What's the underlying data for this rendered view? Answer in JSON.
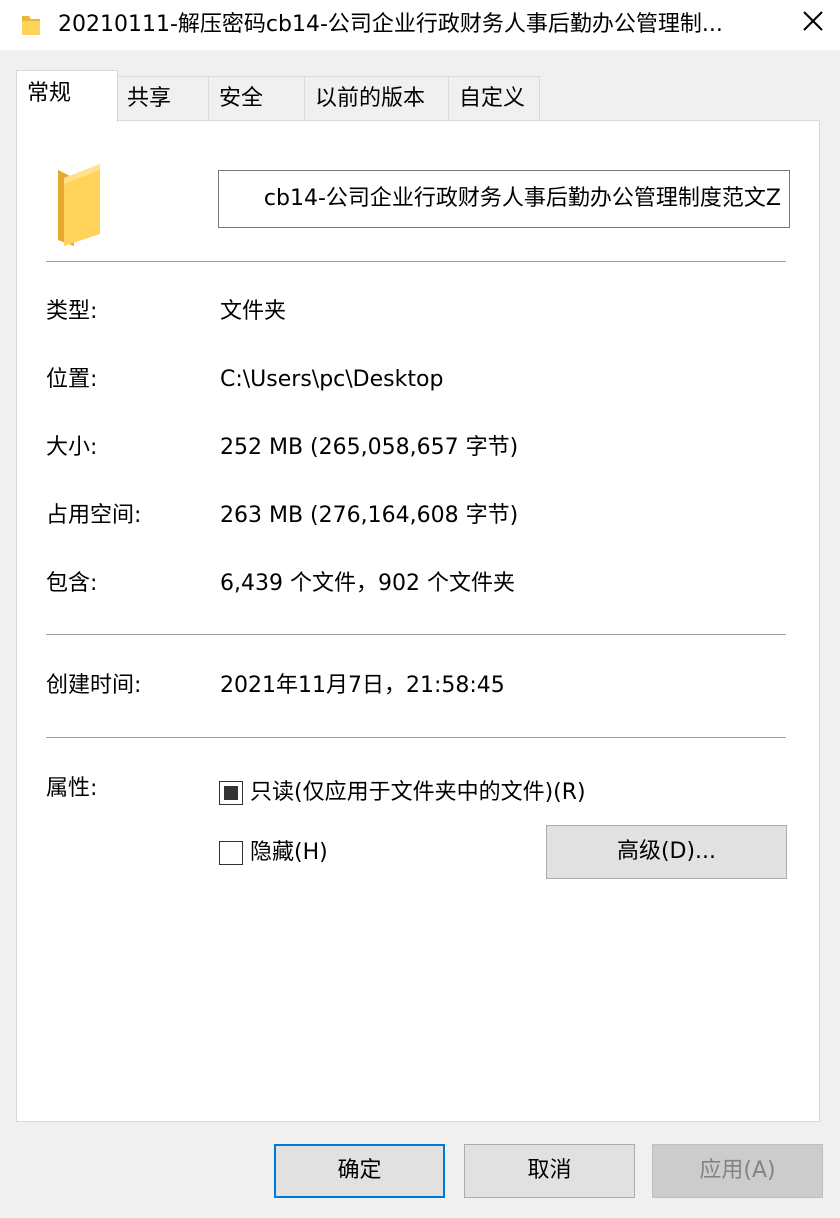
{
  "window": {
    "title": "20210111-解压密码cb14-公司企业行政财务人事后勤办公管理制..."
  },
  "tabs": [
    {
      "label": "常规",
      "active": true
    },
    {
      "label": "共享",
      "active": false
    },
    {
      "label": "安全",
      "active": false
    },
    {
      "label": "以前的版本",
      "active": false
    },
    {
      "label": "自定义",
      "active": false
    }
  ],
  "general": {
    "name_value": "cb14-公司企业行政财务人事后勤办公管理制度范文Z",
    "type_label": "类型:",
    "type_value": "文件夹",
    "location_label": "位置:",
    "location_value": "C:\\Users\\pc\\Desktop",
    "size_label": "大小:",
    "size_value": "252 MB (265,058,657 字节)",
    "disk_label": "占用空间:",
    "disk_value": "263 MB (276,164,608 字节)",
    "contains_label": "包含:",
    "contains_value": "6,439 个文件，902 个文件夹",
    "created_label": "创建时间:",
    "created_value": "2021年11月7日，21:58:45",
    "attributes_label": "属性:",
    "readonly_label": "只读(仅应用于文件夹中的文件)(R)",
    "readonly_state": "indeterminate",
    "hidden_label": "隐藏(H)",
    "hidden_state": "unchecked",
    "advanced_label": "高级(D)..."
  },
  "footer": {
    "ok_label": "确定",
    "cancel_label": "取消",
    "apply_label": "应用(A)"
  },
  "icons": {
    "folder": "folder-icon",
    "close": "close-icon"
  },
  "colors": {
    "folder_yellow": "#ffd35a",
    "default_button_border": "#0078d7"
  }
}
